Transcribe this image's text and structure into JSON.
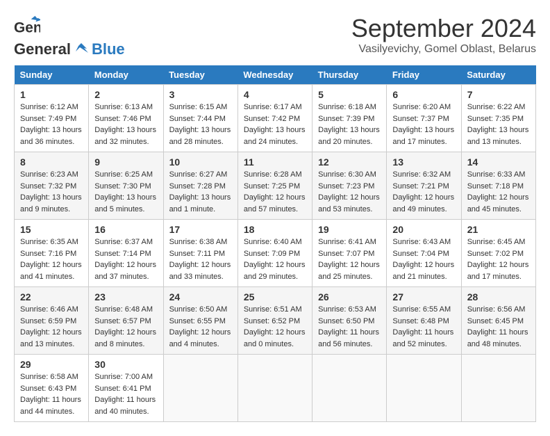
{
  "header": {
    "logo_general": "General",
    "logo_blue": "Blue",
    "month": "September 2024",
    "location": "Vasilyevichy, Gomel Oblast, Belarus"
  },
  "calendar": {
    "days_of_week": [
      "Sunday",
      "Monday",
      "Tuesday",
      "Wednesday",
      "Thursday",
      "Friday",
      "Saturday"
    ],
    "weeks": [
      [
        {
          "day": "",
          "info": ""
        },
        {
          "day": "2",
          "info": "Sunrise: 6:13 AM\nSunset: 7:46 PM\nDaylight: 13 hours\nand 32 minutes."
        },
        {
          "day": "3",
          "info": "Sunrise: 6:15 AM\nSunset: 7:44 PM\nDaylight: 13 hours\nand 28 minutes."
        },
        {
          "day": "4",
          "info": "Sunrise: 6:17 AM\nSunset: 7:42 PM\nDaylight: 13 hours\nand 24 minutes."
        },
        {
          "day": "5",
          "info": "Sunrise: 6:18 AM\nSunset: 7:39 PM\nDaylight: 13 hours\nand 20 minutes."
        },
        {
          "day": "6",
          "info": "Sunrise: 6:20 AM\nSunset: 7:37 PM\nDaylight: 13 hours\nand 17 minutes."
        },
        {
          "day": "7",
          "info": "Sunrise: 6:22 AM\nSunset: 7:35 PM\nDaylight: 13 hours\nand 13 minutes."
        }
      ],
      [
        {
          "day": "1",
          "info": "Sunrise: 6:12 AM\nSunset: 7:49 PM\nDaylight: 13 hours\nand 36 minutes."
        },
        {
          "day": "8",
          "info": ""
        },
        {
          "day": "9",
          "info": ""
        },
        {
          "day": "10",
          "info": ""
        },
        {
          "day": "11",
          "info": ""
        },
        {
          "day": "12",
          "info": ""
        },
        {
          "day": "13",
          "info": ""
        }
      ],
      [
        {
          "day": "8",
          "info": "Sunrise: 6:23 AM\nSunset: 7:32 PM\nDaylight: 13 hours\nand 9 minutes."
        },
        {
          "day": "9",
          "info": "Sunrise: 6:25 AM\nSunset: 7:30 PM\nDaylight: 13 hours\nand 5 minutes."
        },
        {
          "day": "10",
          "info": "Sunrise: 6:27 AM\nSunset: 7:28 PM\nDaylight: 13 hours\nand 1 minute."
        },
        {
          "day": "11",
          "info": "Sunrise: 6:28 AM\nSunset: 7:25 PM\nDaylight: 12 hours\nand 57 minutes."
        },
        {
          "day": "12",
          "info": "Sunrise: 6:30 AM\nSunset: 7:23 PM\nDaylight: 12 hours\nand 53 minutes."
        },
        {
          "day": "13",
          "info": "Sunrise: 6:32 AM\nSunset: 7:21 PM\nDaylight: 12 hours\nand 49 minutes."
        },
        {
          "day": "14",
          "info": "Sunrise: 6:33 AM\nSunset: 7:18 PM\nDaylight: 12 hours\nand 45 minutes."
        }
      ],
      [
        {
          "day": "15",
          "info": "Sunrise: 6:35 AM\nSunset: 7:16 PM\nDaylight: 12 hours\nand 41 minutes."
        },
        {
          "day": "16",
          "info": "Sunrise: 6:37 AM\nSunset: 7:14 PM\nDaylight: 12 hours\nand 37 minutes."
        },
        {
          "day": "17",
          "info": "Sunrise: 6:38 AM\nSunset: 7:11 PM\nDaylight: 12 hours\nand 33 minutes."
        },
        {
          "day": "18",
          "info": "Sunrise: 6:40 AM\nSunset: 7:09 PM\nDaylight: 12 hours\nand 29 minutes."
        },
        {
          "day": "19",
          "info": "Sunrise: 6:41 AM\nSunset: 7:07 PM\nDaylight: 12 hours\nand 25 minutes."
        },
        {
          "day": "20",
          "info": "Sunrise: 6:43 AM\nSunset: 7:04 PM\nDaylight: 12 hours\nand 21 minutes."
        },
        {
          "day": "21",
          "info": "Sunrise: 6:45 AM\nSunset: 7:02 PM\nDaylight: 12 hours\nand 17 minutes."
        }
      ],
      [
        {
          "day": "22",
          "info": "Sunrise: 6:46 AM\nSunset: 6:59 PM\nDaylight: 12 hours\nand 13 minutes."
        },
        {
          "day": "23",
          "info": "Sunrise: 6:48 AM\nSunset: 6:57 PM\nDaylight: 12 hours\nand 8 minutes."
        },
        {
          "day": "24",
          "info": "Sunrise: 6:50 AM\nSunset: 6:55 PM\nDaylight: 12 hours\nand 4 minutes."
        },
        {
          "day": "25",
          "info": "Sunrise: 6:51 AM\nSunset: 6:52 PM\nDaylight: 12 hours\nand 0 minutes."
        },
        {
          "day": "26",
          "info": "Sunrise: 6:53 AM\nSunset: 6:50 PM\nDaylight: 11 hours\nand 56 minutes."
        },
        {
          "day": "27",
          "info": "Sunrise: 6:55 AM\nSunset: 6:48 PM\nDaylight: 11 hours\nand 52 minutes."
        },
        {
          "day": "28",
          "info": "Sunrise: 6:56 AM\nSunset: 6:45 PM\nDaylight: 11 hours\nand 48 minutes."
        }
      ],
      [
        {
          "day": "29",
          "info": "Sunrise: 6:58 AM\nSunset: 6:43 PM\nDaylight: 11 hours\nand 44 minutes."
        },
        {
          "day": "30",
          "info": "Sunrise: 7:00 AM\nSunset: 6:41 PM\nDaylight: 11 hours\nand 40 minutes."
        },
        {
          "day": "",
          "info": ""
        },
        {
          "day": "",
          "info": ""
        },
        {
          "day": "",
          "info": ""
        },
        {
          "day": "",
          "info": ""
        },
        {
          "day": "",
          "info": ""
        }
      ]
    ]
  }
}
